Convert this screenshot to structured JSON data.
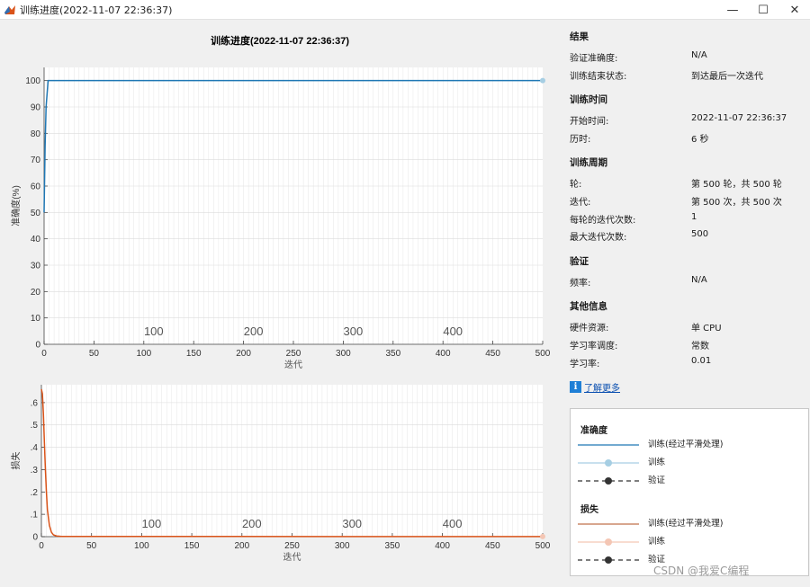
{
  "window": {
    "title": "训练进度(2022-11-07 22:36:37)",
    "controls": [
      "—",
      "☐",
      "✕"
    ]
  },
  "plot_title": "训练进度(2022-11-07 22:36:37)",
  "chart_data": [
    {
      "type": "line",
      "ylabel": "准确度(%)",
      "xlabel": "迭代",
      "xlim": [
        0,
        500
      ],
      "ylim": [
        0,
        105
      ],
      "xticks": [
        0,
        50,
        100,
        150,
        200,
        250,
        300,
        350,
        400,
        450,
        500
      ],
      "yticks": [
        0,
        10,
        20,
        30,
        40,
        50,
        60,
        70,
        80,
        90,
        100
      ],
      "epoch_labels": [
        "100",
        "200",
        "300",
        "400"
      ],
      "epoch_label_positions": [
        100,
        200,
        300,
        400
      ],
      "grid": true,
      "series": [
        {
          "name": "训练(经过平滑处理)",
          "color": "#1f77b4",
          "x": [
            0,
            1,
            2,
            3,
            4,
            5,
            500
          ],
          "y": [
            50,
            75,
            90,
            95,
            100,
            100,
            100
          ]
        },
        {
          "name": "训练",
          "color": "#a6cee3",
          "x": [
            500
          ],
          "y": [
            100
          ]
        }
      ]
    },
    {
      "type": "line",
      "ylabel": "损失",
      "xlabel": "迭代",
      "xlim": [
        0,
        500
      ],
      "ylim": [
        0,
        0.68
      ],
      "xticks": [
        0,
        50,
        100,
        150,
        200,
        250,
        300,
        350,
        400,
        450,
        500
      ],
      "yticks": [
        0,
        0.1,
        0.2,
        0.3,
        0.4,
        0.5,
        0.6
      ],
      "epoch_labels": [
        "100",
        "200",
        "300",
        "400"
      ],
      "epoch_label_positions": [
        100,
        200,
        300,
        400
      ],
      "grid": true,
      "series": [
        {
          "name": "训练(经过平滑处理)",
          "color": "#d95319",
          "x": [
            0,
            1,
            2,
            3,
            4,
            5,
            6,
            8,
            10,
            12,
            15,
            20,
            500
          ],
          "y": [
            0.66,
            0.64,
            0.55,
            0.42,
            0.3,
            0.2,
            0.12,
            0.05,
            0.02,
            0.008,
            0.003,
            0.001,
            0.0005
          ]
        },
        {
          "name": "训练",
          "color": "#f4c6b4",
          "x": [
            500
          ],
          "y": [
            0.0005
          ]
        }
      ]
    }
  ],
  "info": {
    "results": {
      "title": "结果",
      "rows": [
        {
          "k": "验证准确度:",
          "v": "N/A"
        },
        {
          "k": "训练结束状态:",
          "v": "到达最后一次迭代"
        }
      ]
    },
    "time": {
      "title": "训练时间",
      "rows": [
        {
          "k": "开始时间:",
          "v": "2022-11-07 22:36:37"
        },
        {
          "k": "历时:",
          "v": "6 秒"
        }
      ]
    },
    "cycle": {
      "title": "训练周期",
      "rows": [
        {
          "k": "轮:",
          "v": "第 500 轮，共 500 轮"
        },
        {
          "k": "迭代:",
          "v": "第 500 次，共 500 次"
        },
        {
          "k": "每轮的迭代次数:",
          "v": "1"
        },
        {
          "k": "最大迭代次数:",
          "v": "500"
        }
      ]
    },
    "validation": {
      "title": "验证",
      "rows": [
        {
          "k": "频率:",
          "v": "N/A"
        }
      ]
    },
    "other": {
      "title": "其他信息",
      "rows": [
        {
          "k": "硬件资源:",
          "v": "单 CPU"
        },
        {
          "k": "学习率调度:",
          "v": "常数"
        },
        {
          "k": "学习率:",
          "v": "0.01"
        }
      ]
    },
    "learn_more": "了解更多",
    "info_icon_glyph": "i"
  },
  "legend": {
    "accuracy": {
      "title": "准确度",
      "items": [
        "训练(经过平滑处理)",
        "训练",
        "验证"
      ]
    },
    "loss": {
      "title": "损失",
      "items": [
        "训练(经过平滑处理)",
        "训练",
        "验证"
      ]
    },
    "colors": {
      "acc_smooth": "#1f77b4",
      "acc_train": "#a6cee3",
      "loss_smooth": "#c0704a",
      "loss_train": "#f4c6b4",
      "validation": "#333333"
    }
  },
  "watermark": "CSDN @我爱C编程"
}
